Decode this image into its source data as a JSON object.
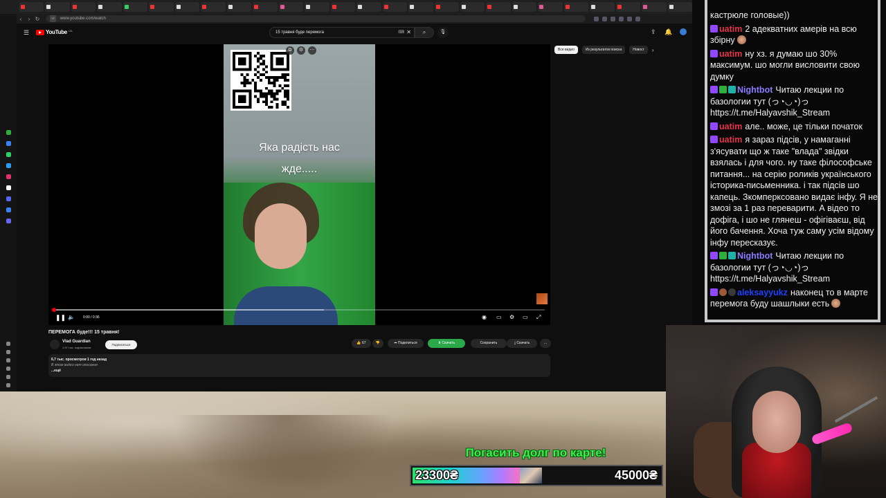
{
  "browser": {
    "url": "www.youtube.com/watch",
    "site_badge": "YT"
  },
  "youtube": {
    "logo_text": "YouTube",
    "logo_sup": "UA",
    "search_query": "15 травня буде перемога",
    "chips": [
      "Все видео",
      "Из результатов поиска",
      "Новост"
    ],
    "player": {
      "overlay_text_line1": "Яка радість нас",
      "overlay_text_line2": "жде.....",
      "time": "0:00 / 0:36",
      "progress_played": 0.0,
      "progress_loaded": 0.55
    },
    "video": {
      "title": "ПЕРЕМОГА буде!!! 15 травня!",
      "channel": "Vlad Guardian",
      "subscribers": "1,97 тыс. подписчиков",
      "subscribe_label": "Подписаться",
      "likes": "67",
      "share_label": "Поделиться",
      "download_green_label": "Скачать",
      "save_label": "Сохранить",
      "download_label": "Скачать",
      "more_label": "...",
      "stats": "6,7 тыс. просмотров  1 год назад",
      "description": "В этом видео нет описания",
      "show_more": "...ещё"
    }
  },
  "stream": {
    "goal_title": "Погасить долг по карте!",
    "goal_current": "23300₴",
    "goal_target": "45000₴",
    "goal_progress": 0.518,
    "accent_green": "#3ef04e"
  },
  "chat": {
    "messages": [
      {
        "nick": "",
        "nick_color": "#ffffff",
        "text": "кастрюле головые))",
        "badges": []
      },
      {
        "nick": "uatim",
        "nick_color": "#e5334b",
        "text": "2 адекватних амерів на всю збірну",
        "badges": [
          "twitch"
        ],
        "emote": true
      },
      {
        "nick": "uatim",
        "nick_color": "#e5334b",
        "text": "ну хз. я думаю шо 30% максимум. шо могли висловити свою думку",
        "badges": [
          "twitch"
        ]
      },
      {
        "nick": "Nightbot",
        "nick_color": "#8b7bff",
        "text": "Читаю лекции по базологии тут (っ◔◡◔)っ https://t.me/Halyavshik_Stream",
        "badges": [
          "twitch",
          "mod",
          "bot"
        ]
      },
      {
        "nick": "uatim",
        "nick_color": "#e5334b",
        "text": "але.. може, це тільки початок",
        "badges": [
          "twitch"
        ]
      },
      {
        "nick": "uatim",
        "nick_color": "#e5334b",
        "text": "я зараз підсів, у намаганні з'ясувати що ж таке \"влада\" звідки взялась і для чого. ну таке філософське питання... на серію роликів українського історика-письменника. і так підсів шо капець. Зкомперксовано видає інфу. Я не змозі за 1 раз переварити. А відео то дофіга, і шо не глянеш - офігіваєш, від його бачення. Хоча туж саму усім відому інфу пересказує.",
        "badges": [
          "twitch"
        ]
      },
      {
        "nick": "Nightbot",
        "nick_color": "#8b7bff",
        "text": "Читаю лекции по базологии тут (っ◔◡◔)っ https://t.me/Halyavshik_Stream",
        "badges": [
          "twitch",
          "mod",
          "bot"
        ]
      },
      {
        "nick": "aleksayyukz",
        "nick_color": "#1e40ff",
        "text": "наконец то в марте перемога буду шашлыки есть",
        "badges": [
          "twitch",
          "sub",
          "dark"
        ],
        "emote": true
      }
    ]
  }
}
